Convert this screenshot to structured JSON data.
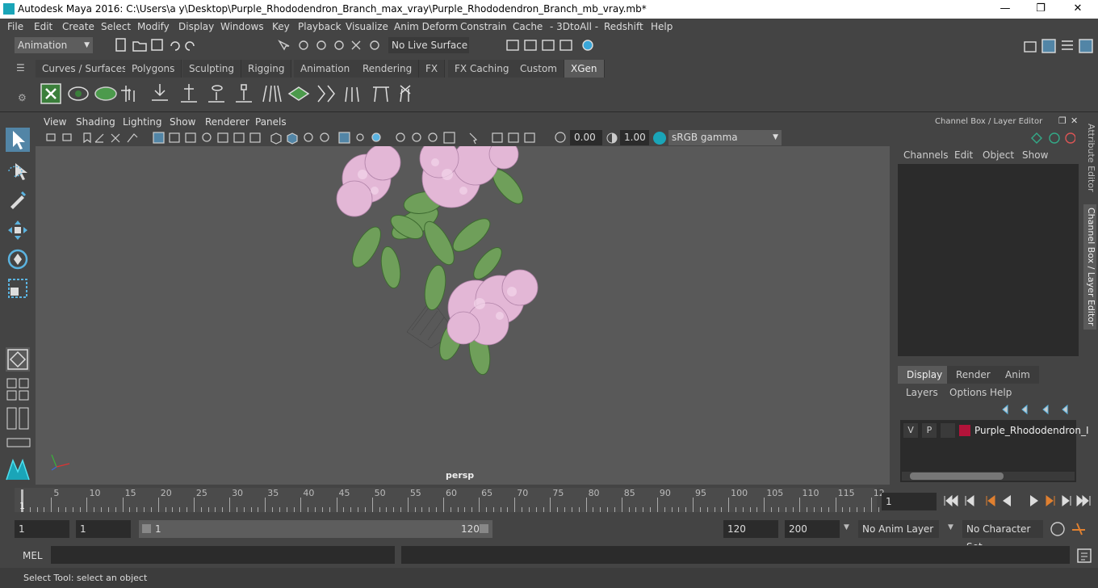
{
  "window": {
    "title": "Autodesk Maya 2016: C:\\Users\\a y\\Desktop\\Purple_Rhododendron_Branch_max_vray\\Purple_Rhododendron_Branch_mb_vray.mb*",
    "minimize": "—",
    "maximize": "❐",
    "close": "✕"
  },
  "menubar": [
    "File",
    "Edit",
    "Create",
    "Select",
    "Modify",
    "Display",
    "Windows",
    "Key",
    "Playback",
    "Visualize",
    "Anim Deform",
    "Constrain",
    "Cache",
    "- 3DtoAll -",
    "Redshift",
    "Help"
  ],
  "statusline": {
    "mode": "Animation",
    "live_surface": "No Live Surface"
  },
  "shelf_tabs": [
    {
      "label": "Curves / Surfaces",
      "active": false
    },
    {
      "label": "Polygons",
      "active": false
    },
    {
      "label": "Sculpting",
      "active": false
    },
    {
      "label": "Rigging",
      "active": false
    },
    {
      "label": "Animation",
      "active": false
    },
    {
      "label": "Rendering",
      "active": false
    },
    {
      "label": "FX",
      "active": false
    },
    {
      "label": "FX Caching",
      "active": false
    },
    {
      "label": "Custom",
      "active": false
    },
    {
      "label": "XGen",
      "active": true
    }
  ],
  "viewport": {
    "menus": [
      "View",
      "Shading",
      "Lighting",
      "Show",
      "Renderer",
      "Panels"
    ],
    "exposure": "0.00",
    "gamma": "1.00",
    "color_space": "sRGB gamma",
    "camera": "persp"
  },
  "channel_box": {
    "title": "Channel Box / Layer Editor",
    "menus": [
      "Channels",
      "Edit",
      "Object",
      "Show"
    ],
    "layer_tabs": [
      {
        "label": "Display",
        "active": true
      },
      {
        "label": "Render",
        "active": false
      },
      {
        "label": "Anim",
        "active": false
      }
    ],
    "layer_menus": [
      "Layers",
      "Options",
      "Help"
    ],
    "layer": {
      "v": "V",
      "p": "P",
      "name": "Purple_Rhododendron_I",
      "color": "#b3133a"
    }
  },
  "side_tabs": [
    "Attribute Editor",
    "Channel Box / Layer Editor"
  ],
  "timeline": {
    "labels": [
      "5",
      "10",
      "15",
      "20",
      "25",
      "30",
      "35",
      "40",
      "45",
      "50",
      "55",
      "60",
      "65",
      "70",
      "75",
      "80",
      "85",
      "90",
      "95",
      "100",
      "105",
      "110",
      "115",
      "12"
    ],
    "start_label": "1",
    "current_frame": "1"
  },
  "range": {
    "start": "1",
    "playback_start": "1",
    "slider_start": "1",
    "slider_end": "120",
    "playback_end": "120",
    "end": "200",
    "anim_layer": "No Anim Layer",
    "char_set": "No Character Set"
  },
  "command": {
    "label": "MEL"
  },
  "help_line": "Select Tool: select an object",
  "colors": {
    "accent": "#5285a6",
    "bg": "#444444",
    "panel": "#2b2b2b",
    "viewport": "#595959"
  }
}
